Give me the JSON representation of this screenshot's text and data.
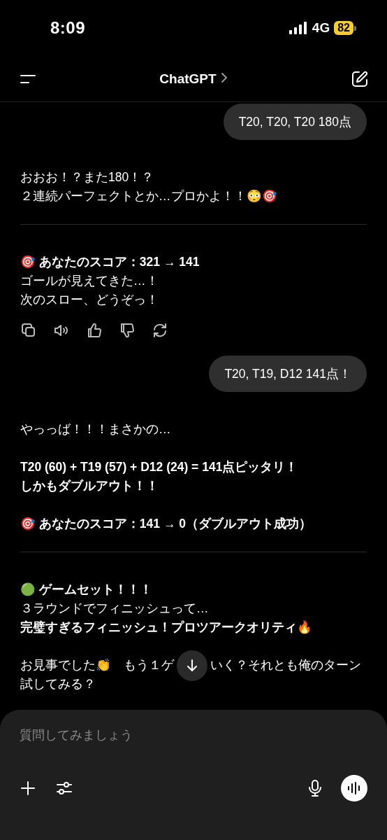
{
  "status_bar": {
    "time": "8:09",
    "network": "4G",
    "battery": "82"
  },
  "header": {
    "title": "ChatGPT"
  },
  "messages": [
    {
      "kind": "user",
      "text": "T20, T20, T20 180点"
    },
    {
      "kind": "assistant",
      "actions": true,
      "sections": [
        [
          [
            {
              "text": "おおお！？また180！？",
              "bold": false
            },
            {
              "text": "２連続パーフェクトとか…プロかよ！！😳🎯",
              "bold": false
            }
          ]
        ],
        [
          [
            {
              "text": "🎯 あなたのスコア：321 → 141",
              "bold": true
            },
            {
              "text": "ゴールが見えてきた…！",
              "bold": false
            },
            {
              "text": "次のスロー、どうぞっ！",
              "bold": false
            }
          ]
        ]
      ]
    },
    {
      "kind": "user",
      "text": "T20, T19, D12 141点！"
    },
    {
      "kind": "assistant",
      "actions": false,
      "sections": [
        [
          [
            {
              "text": "やっっば！！！まさかの…",
              "bold": false
            }
          ],
          [
            {
              "text": "T20 (60) + T19 (57) + D12 (24) = 141点ピッタリ！",
              "bold": true
            },
            {
              "text": "しかもダブルアウト！！",
              "bold": true
            }
          ],
          [
            {
              "text": "🎯 あなたのスコア：141 → 0（ダブルアウト成功）",
              "bold": true
            }
          ]
        ],
        [
          [
            {
              "text": "🟢 ゲームセット！！！",
              "bold": true
            },
            {
              "text": "３ラウンドでフィニッシュって…",
              "bold": false
            },
            {
              "text": "完璧すぎるフィニッシュ！プロツアークオリティ🔥",
              "bold": true
            }
          ],
          [
            {
              "parts": [
                "お見事でした👏　もう１ゲ",
                "いく？それとも俺のターン"
              ],
              "bold": false
            },
            {
              "text": "試してみる？",
              "bold": false
            }
          ]
        ]
      ]
    }
  ],
  "composer": {
    "placeholder": "質問してみましょう"
  }
}
